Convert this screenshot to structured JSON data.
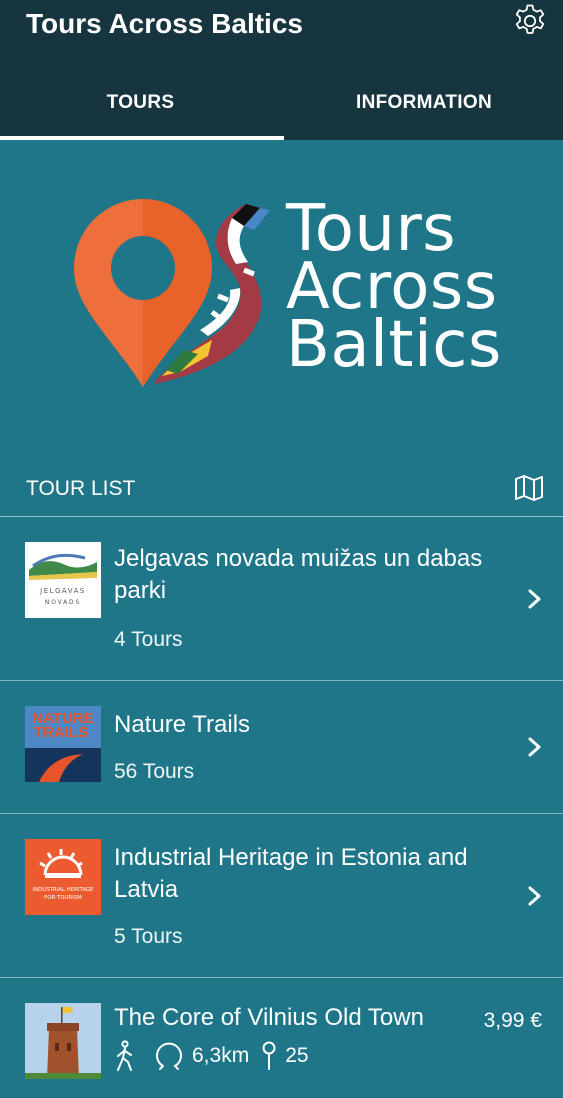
{
  "app": {
    "title": "Tours Across Baltics"
  },
  "tabs": [
    {
      "label": "TOURS",
      "active": true
    },
    {
      "label": "INFORMATION",
      "active": false
    }
  ],
  "brand": {
    "lines": [
      "Tours",
      "Across",
      "Baltics"
    ]
  },
  "tour_list": {
    "header": "TOUR LIST",
    "items": [
      {
        "title": "Jelgavas novada muižas un dabas parki",
        "subtitle": "4 Tours",
        "thumb_text": [
          "JELGAVAS",
          "NOVADS"
        ]
      },
      {
        "title": "Nature Trails",
        "subtitle": "56 Tours",
        "thumb_text": [
          "NATURE",
          "TRAILS"
        ]
      },
      {
        "title": "Industrial Heritage in Estonia and Latvia",
        "subtitle": "5 Tours",
        "thumb_text": [
          "INDUSTRIAL HERITAGE",
          "FOR TOURISM"
        ]
      },
      {
        "title": "The Core of Vilnius Old Town",
        "price": "3,99 €",
        "distance": "6,3km",
        "stops": "25"
      }
    ]
  },
  "colors": {
    "appbar": "#17353e",
    "background": "#1f7688",
    "pin_orange": "#e8622a",
    "text": "#ffffff"
  },
  "icons": [
    "gear-icon",
    "map-icon",
    "chevron-right-icon",
    "walking-icon",
    "loop-route-icon",
    "pin-icon"
  ]
}
